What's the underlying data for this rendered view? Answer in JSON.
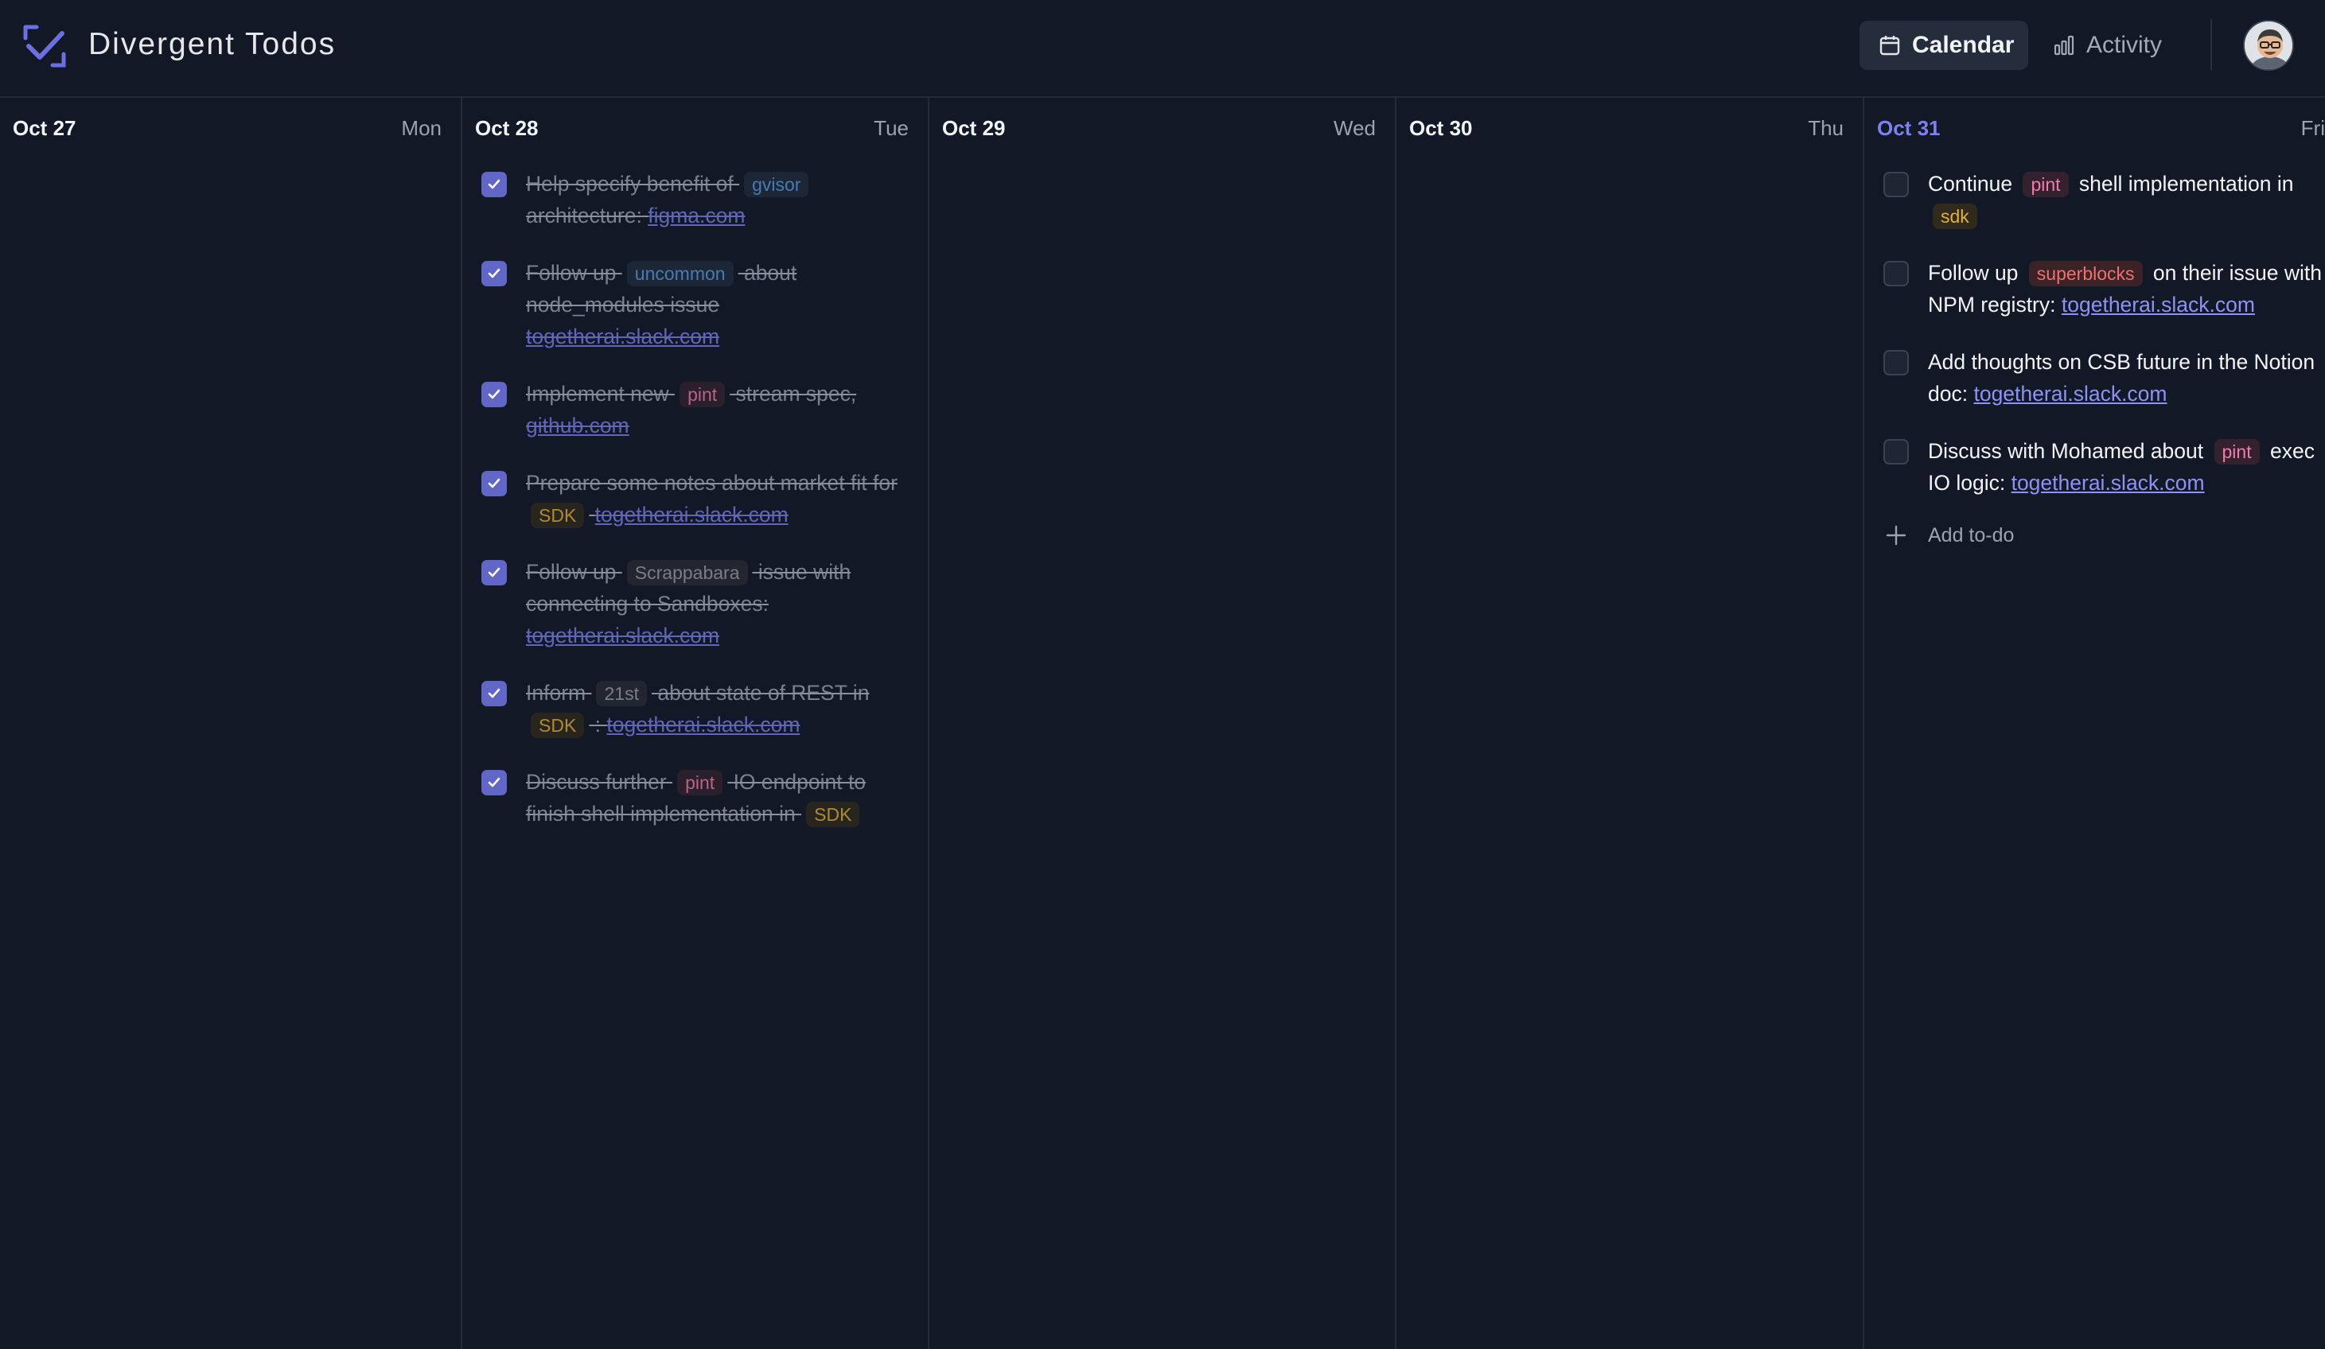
{
  "app": {
    "title": "Divergent Todos"
  },
  "nav": {
    "calendar": "Calendar",
    "activity": "Activity"
  },
  "columns": [
    {
      "date": "Oct 27",
      "day": "Mon",
      "todos": []
    },
    {
      "date": "Oct 28",
      "day": "Tue",
      "todos": [
        {
          "done": true,
          "parts": [
            "Help specify benefit of",
            "gvisor",
            "architecture:",
            "figma.com"
          ]
        },
        {
          "done": true,
          "parts": [
            "Follow up",
            "uncommon",
            "about node_modules issue",
            "togetherai.slack.com"
          ]
        },
        {
          "done": true,
          "parts": [
            "Implement new",
            "pint",
            "stream spec,",
            "github.com"
          ]
        },
        {
          "done": true,
          "parts": [
            "Prepare some notes about market fit for",
            "SDK",
            "togetherai.slack.com"
          ]
        },
        {
          "done": true,
          "parts": [
            "Follow up",
            "Scrappabara",
            "issue with connecting to Sandboxes:",
            "togetherai.slack.com"
          ]
        },
        {
          "done": true,
          "parts": [
            "Inform",
            "21st",
            "about state of REST in",
            "SDK",
            ":",
            "togetherai.slack.com"
          ]
        },
        {
          "done": true,
          "parts": [
            "Discuss further",
            "pint",
            "IO endpoint to finish shell implementation in",
            "SDK"
          ]
        }
      ]
    },
    {
      "date": "Oct 29",
      "day": "Wed",
      "todos": []
    },
    {
      "date": "Oct 30",
      "day": "Thu",
      "todos": []
    },
    {
      "date": "Oct 31",
      "day": "Fri",
      "todos": [
        {
          "done": false,
          "parts": [
            "Continue",
            "pint",
            "shell implementation in",
            "sdk"
          ]
        },
        {
          "done": false,
          "parts": [
            "Follow up",
            "superblocks",
            "on their issue with NPM registry:",
            "togetherai.slack.com"
          ]
        },
        {
          "done": false,
          "parts": [
            "Add thoughts on CSB future in the Notion doc:",
            "togetherai.slack.com"
          ]
        },
        {
          "done": false,
          "parts": [
            "Discuss with Mohamed about",
            "pint",
            "exec IO logic:",
            "togetherai.slack.com"
          ]
        }
      ],
      "add_label": "Add to-do"
    }
  ],
  "colors": {
    "accent": "#6266c7",
    "today": "#7b82f0",
    "background": "#121826"
  }
}
